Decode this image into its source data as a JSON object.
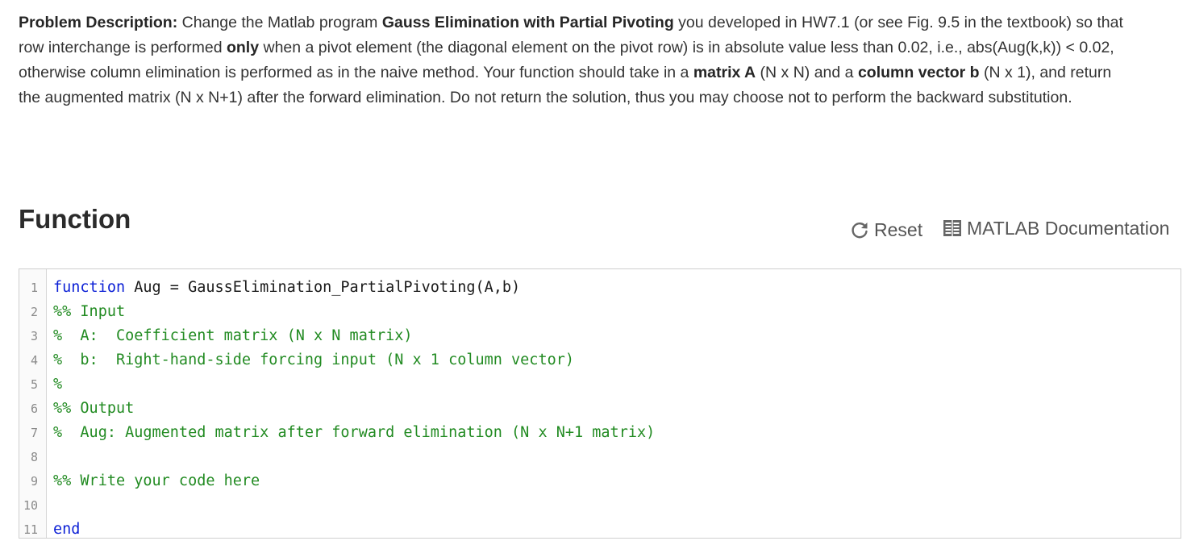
{
  "description": {
    "label": "Problem Description:",
    "t1": " Change the Matlab program ",
    "b1": "Gauss Elimination with Partial Pivoting",
    "t2": " you developed in HW7.1 (or see Fig. 9.5 in the textbook) so that row interchange is performed ",
    "b2": "only",
    "t3": " when a pivot element (the diagonal element on the pivot row) is in absolute value less than 0.02, i.e., abs(Aug(k,k)) < 0.02, otherwise column elimination is performed as in the naive method. Your function should take in a ",
    "b3": "matrix A",
    "t4": " (N x N) and a ",
    "b4": "column vector b",
    "t5": " (N x 1), and return the augmented matrix (N x N+1) after the forward elimination. Do not return the solution, thus you may choose not to perform the backward substitution."
  },
  "section": {
    "title": "Function",
    "reset_label": "Reset",
    "docs_label": "MATLAB Documentation"
  },
  "editor": {
    "lines": [
      {
        "num": "1",
        "kw": "function",
        "code": " Aug = GaussElimination_PartialPivoting(A,b)",
        "comment": ""
      },
      {
        "num": "2",
        "kw": "",
        "code": "",
        "comment": "%% Input"
      },
      {
        "num": "3",
        "kw": "",
        "code": "",
        "comment": "%  A:  Coefficient matrix (N x N matrix)"
      },
      {
        "num": "4",
        "kw": "",
        "code": "",
        "comment": "%  b:  Right-hand-side forcing input (N x 1 column vector)"
      },
      {
        "num": "5",
        "kw": "",
        "code": "",
        "comment": "%"
      },
      {
        "num": "6",
        "kw": "",
        "code": "",
        "comment": "%% Output"
      },
      {
        "num": "7",
        "kw": "",
        "code": "",
        "comment": "%  Aug: Augmented matrix after forward elimination (N x N+1 matrix)"
      },
      {
        "num": "8",
        "kw": "",
        "code": "",
        "comment": ""
      },
      {
        "num": "9",
        "kw": "",
        "code": "",
        "comment": "%% Write your code here"
      },
      {
        "num": "10",
        "kw": "",
        "code": "",
        "comment": ""
      },
      {
        "num": "11",
        "kw": "end",
        "code": "",
        "comment": ""
      }
    ]
  },
  "icons": {
    "reset": "reset-arrow-icon",
    "docs": "book-icon"
  }
}
